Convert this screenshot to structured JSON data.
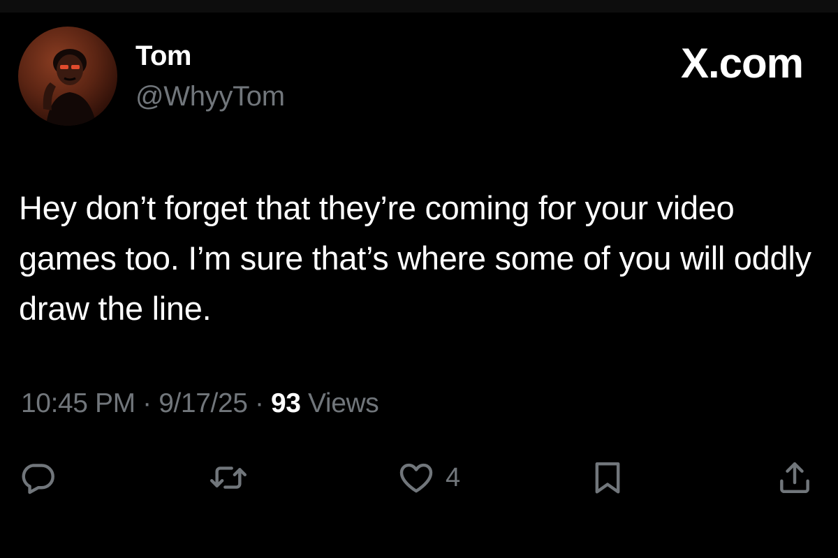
{
  "author": {
    "display_name": "Tom",
    "handle": "@WhyyTom"
  },
  "brand": "X.com",
  "tweet": {
    "text": "Hey don’t forget that they’re coming for your video games too. I’m sure that’s where some of you will oddly draw the line."
  },
  "meta": {
    "time": "10:45 PM",
    "separator": " · ",
    "date": "9/17/25",
    "views_count": "93",
    "views_label": " Views"
  },
  "actions": {
    "reply_icon": "reply-icon",
    "retweet_icon": "retweet-icon",
    "like_icon": "heart-icon",
    "like_count": "4",
    "bookmark_icon": "bookmark-icon",
    "share_icon": "share-icon"
  },
  "colors": {
    "background": "#000000",
    "primary_text": "#ffffff",
    "secondary_text": "#71767b"
  }
}
